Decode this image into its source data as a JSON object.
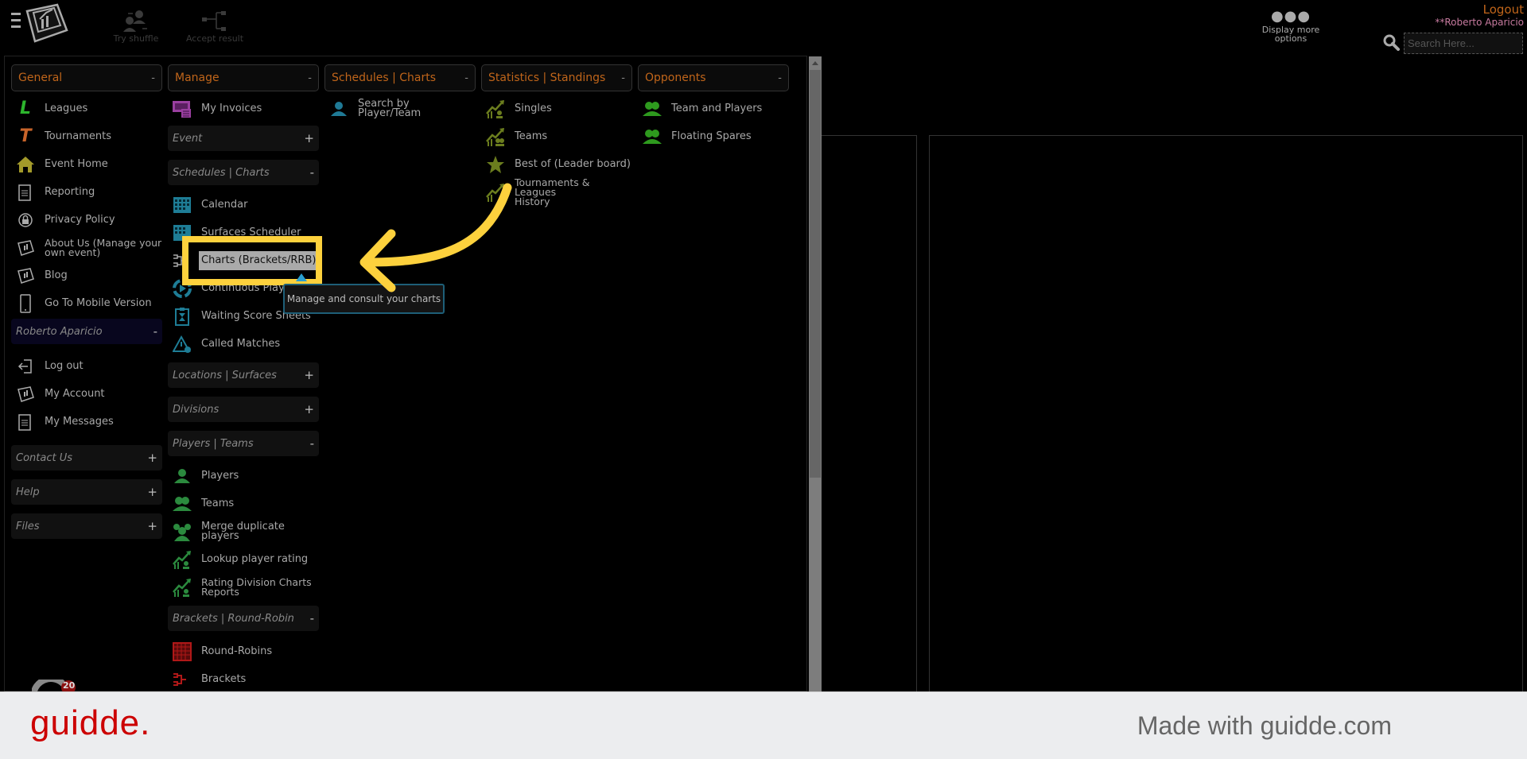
{
  "topbar": {
    "tools": [
      {
        "label": "Try shuffle",
        "icon": "shuffle-users-icon"
      },
      {
        "label": "Accept result",
        "icon": "bracket-tree-icon"
      }
    ],
    "more_options": {
      "icon": "ellipsis-icon",
      "label": "Display more options"
    },
    "logout_label": "Logout",
    "user_name": "**Roberto Aparicio",
    "search": {
      "placeholder": "Search Here...",
      "value": ""
    }
  },
  "menu": {
    "general": {
      "title": "General",
      "toggle": "-",
      "items": [
        {
          "label": "Leagues",
          "icon": "leagues-L-icon"
        },
        {
          "label": "Tournaments",
          "icon": "tournaments-T-icon"
        },
        {
          "label": "Event Home",
          "icon": "home-icon"
        },
        {
          "label": "Reporting",
          "icon": "document-icon"
        },
        {
          "label": "Privacy Policy",
          "icon": "lock-icon"
        },
        {
          "label": "About Us (Manage your own event)",
          "icon": "app-logo-icon"
        },
        {
          "label": "Blog",
          "icon": "app-logo-icon"
        },
        {
          "label": "Go To Mobile Version",
          "icon": "mobile-phone-icon"
        }
      ],
      "user_section": {
        "title": "Roberto Aparicio",
        "toggle": "-"
      },
      "user_items": [
        {
          "label": "Log out",
          "icon": "logout-icon"
        },
        {
          "label": "My Account",
          "icon": "app-logo-icon"
        },
        {
          "label": "My Messages",
          "icon": "document-icon"
        }
      ],
      "sections": [
        {
          "title": "Contact Us",
          "toggle": "+"
        },
        {
          "title": "Help",
          "toggle": "+"
        },
        {
          "title": "Files",
          "toggle": "+"
        }
      ]
    },
    "manage": {
      "title": "Manage",
      "toggle": "-",
      "top_items": [
        {
          "label": "My Invoices",
          "icon": "invoice-icon"
        }
      ],
      "event": {
        "title": "Event",
        "toggle": "+"
      },
      "schedules": {
        "title": "Schedules | Charts",
        "toggle": "-"
      },
      "schedule_items": [
        {
          "label": "Calendar",
          "icon": "calendar-icon"
        },
        {
          "label": "Surfaces Scheduler",
          "icon": "calendar-grid-icon"
        },
        {
          "label": "Charts (Brackets/RRB)",
          "icon": "bracket-icon"
        },
        {
          "label": "Continuous Play",
          "icon": "cycle-play-icon"
        },
        {
          "label": "Waiting Score Sheets",
          "icon": "hourglass-clipboard-icon"
        },
        {
          "label": "Called Matches",
          "icon": "warning-check-icon"
        }
      ],
      "locations": {
        "title": "Locations | Surfaces",
        "toggle": "+"
      },
      "divisions": {
        "title": "Divisions",
        "toggle": "+"
      },
      "players_teams": {
        "title": "Players | Teams",
        "toggle": "-"
      },
      "player_items": [
        {
          "label": "Players",
          "icon": "player-icon"
        },
        {
          "label": "Teams",
          "icon": "team-icon"
        },
        {
          "label": "Merge duplicate players",
          "icon": "group-icon"
        },
        {
          "label": "Lookup player rating",
          "icon": "rating-chart-icon"
        },
        {
          "label": "Rating Division Charts Reports",
          "icon": "rating-chart-icon"
        }
      ],
      "brackets": {
        "title": "Brackets | Round-Robin",
        "toggle": "-"
      },
      "bracket_items": [
        {
          "label": "Round-Robins",
          "icon": "round-robin-grid-icon"
        },
        {
          "label": "Brackets",
          "icon": "bracket-icon"
        }
      ]
    },
    "schedules_charts": {
      "title": "Schedules | Charts",
      "toggle": "-",
      "items": [
        {
          "label": "Search by Player/Team",
          "icon": "player-search-icon"
        }
      ]
    },
    "statistics": {
      "title": "Statistics | Standings",
      "toggle": "-",
      "items": [
        {
          "label": "Singles",
          "icon": "stats-player-icon"
        },
        {
          "label": "Teams",
          "icon": "stats-team-icon"
        },
        {
          "label": "Best of (Leader board)",
          "icon": "star-icon"
        },
        {
          "label": "Tournaments & Leagues History",
          "icon": "stats-history-icon"
        }
      ]
    },
    "opponents": {
      "title": "Opponents",
      "toggle": "-",
      "items": [
        {
          "label": "Team and Players",
          "icon": "team-icon"
        },
        {
          "label": "Floating Spares",
          "icon": "team-icon"
        }
      ]
    }
  },
  "tooltip": {
    "text": "Manage and consult your charts"
  },
  "badge": {
    "count": "20"
  },
  "footer": {
    "brand": "guidde.",
    "made_with": "Made with guidde.com"
  },
  "colors": {
    "accent_orange": "#c0651a",
    "highlight_yellow": "#fdd13d",
    "brand_red": "#cc0000"
  }
}
